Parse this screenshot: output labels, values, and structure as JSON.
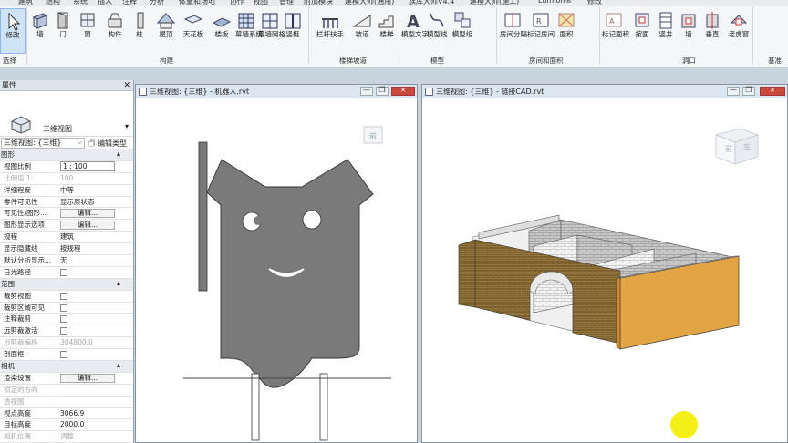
{
  "ribbon": {
    "tabs": [
      "建筑",
      "结构",
      "系统",
      "插入",
      "注释",
      "分析",
      "体量和场地",
      "协作",
      "视图",
      "管理",
      "附加模块",
      "建模大师(通用)",
      "族库大师V4.4",
      "建模大师(施工)",
      "Lumion®",
      "修改"
    ],
    "buttons": [
      {
        "id": "modify",
        "label": "修改"
      },
      {
        "id": "wall",
        "label": "墙"
      },
      {
        "id": "door",
        "label": "门"
      },
      {
        "id": "window",
        "label": "窗"
      },
      {
        "id": "component",
        "label": "构件"
      },
      {
        "id": "column",
        "label": "柱"
      },
      {
        "id": "roof",
        "label": "屋顶"
      },
      {
        "id": "ceiling",
        "label": "天花板"
      },
      {
        "id": "floor",
        "label": "楼板"
      },
      {
        "id": "curtain-system",
        "label": "幕墙系统"
      },
      {
        "id": "curtain-grid",
        "label": "幕墙网格"
      },
      {
        "id": "mullion",
        "label": "竖梃"
      },
      {
        "id": "railing",
        "label": "栏杆扶手"
      },
      {
        "id": "ramp",
        "label": "坡道"
      },
      {
        "id": "stair",
        "label": "楼梯"
      },
      {
        "id": "model-text",
        "label": "模型文字"
      },
      {
        "id": "model-line",
        "label": "模型线"
      },
      {
        "id": "model-group",
        "label": "模型组"
      },
      {
        "id": "room-separator",
        "label": "房间分隔"
      },
      {
        "id": "tag-room",
        "label": "标记房间"
      },
      {
        "id": "area",
        "label": "面积"
      },
      {
        "id": "tag-area",
        "label": "标记面积"
      },
      {
        "id": "by-face",
        "label": "按面"
      },
      {
        "id": "shaft",
        "label": "竖井"
      },
      {
        "id": "opening-wall",
        "label": "墙"
      },
      {
        "id": "vertical",
        "label": "垂直"
      },
      {
        "id": "dormer",
        "label": "老虎窗"
      }
    ],
    "panels": {
      "select": "选择",
      "build": "构建",
      "circulation": "楼梯坡道",
      "model": "模型",
      "room_area": "房间和面积",
      "opening": "洞口",
      "datum": "基准"
    }
  },
  "properties": {
    "title": "属性",
    "type_name": "三维视图",
    "selector": "三维视图: {三维}",
    "edit_type": "编辑类型",
    "rows": [
      {
        "kind": "section",
        "k": "图形"
      },
      {
        "kind": "box",
        "k": "视图比例",
        "v": "1 : 100"
      },
      {
        "kind": "dim",
        "k": "比例值 1:",
        "v": "100"
      },
      {
        "kind": "text",
        "k": "详细程度",
        "v": "中等"
      },
      {
        "kind": "text",
        "k": "零件可见性",
        "v": "显示原状态"
      },
      {
        "kind": "button",
        "k": "可见性/图形...",
        "v": "编辑..."
      },
      {
        "kind": "button",
        "k": "图形显示选项",
        "v": "编辑..."
      },
      {
        "kind": "text",
        "k": "规程",
        "v": "建筑"
      },
      {
        "kind": "text",
        "k": "显示隐藏线",
        "v": "按规程"
      },
      {
        "kind": "text",
        "k": "默认分析显示...",
        "v": "无"
      },
      {
        "kind": "check",
        "k": "日光路径"
      },
      {
        "kind": "section",
        "k": "范围"
      },
      {
        "kind": "check",
        "k": "裁剪视图"
      },
      {
        "kind": "check",
        "k": "裁剪区域可见"
      },
      {
        "kind": "check",
        "k": "注释裁剪"
      },
      {
        "kind": "check",
        "k": "远剪裁激活"
      },
      {
        "kind": "dim",
        "k": "远剪裁偏移",
        "v": "304800.0"
      },
      {
        "kind": "check",
        "k": "剖面框"
      },
      {
        "kind": "section",
        "k": "相机"
      },
      {
        "kind": "button",
        "k": "渲染设置",
        "v": "编辑..."
      },
      {
        "kind": "dim",
        "k": "锁定的方向",
        "v": ""
      },
      {
        "kind": "dim",
        "k": "透视图",
        "v": ""
      },
      {
        "kind": "text",
        "k": "视点高度",
        "v": "3066.9"
      },
      {
        "kind": "text",
        "k": "目标高度",
        "v": "2000.0"
      },
      {
        "kind": "dim",
        "k": "相机位置",
        "v": "调整"
      }
    ]
  },
  "view1": {
    "title": "三维视图: {三维} - 机器人.rvt",
    "viewcube_label": "前"
  },
  "view2": {
    "title": "三维视图: {三维} - 链接CAD.rvt",
    "viewcube_top": "前",
    "viewcube_right": "左"
  },
  "colors": {
    "robot_fill": "#7a7a7a",
    "brick": "#7a5e2c",
    "wood": "#e3a443",
    "cursor": "#f4ef16"
  }
}
